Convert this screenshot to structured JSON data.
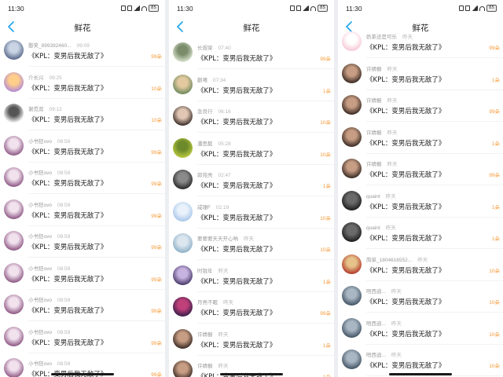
{
  "colors": {
    "accent": "#29a8ee",
    "count": "#f59a3a",
    "page_bg": "#eceef2"
  },
  "panels": [
    {
      "status": {
        "time": "11:30",
        "battery": "85"
      },
      "header": {
        "title": "鲜花",
        "back_icon": "back-arrow-icon"
      },
      "rows": [
        {
          "name": "憨笑_899392460...",
          "time": "09:09",
          "text": "《KPL：变男后我无敌了》",
          "count": "99朵",
          "avatar": [
            "#5a6a8c",
            "#c9d4e4"
          ]
        },
        {
          "name": "介长兴",
          "time": "09:25",
          "text": "《KPL：变男后我无敌了》",
          "count": "10朵",
          "avatar": [
            "#b48bd6",
            "#ffcf8a"
          ]
        },
        {
          "name": "谢觅双",
          "time": "09:12",
          "text": "《KPL：变男后我无敌了》",
          "count": "10朵",
          "avatar": [
            "#ffffff",
            "#555555"
          ]
        },
        {
          "name": "小书狂ovo",
          "time": "08:59",
          "text": "《KPL：变男后我无敌了》",
          "count": "99朵",
          "avatar": [
            "#8f5a86",
            "#f2e2ee"
          ]
        },
        {
          "name": "小书狂ovo",
          "time": "08:59",
          "text": "《KPL：变男后我无敌了》",
          "count": "99朵",
          "avatar": [
            "#8f5a86",
            "#f2e2ee"
          ]
        },
        {
          "name": "小书狂ovo",
          "time": "08:59",
          "text": "《KPL：变男后我无敌了》",
          "count": "99朵",
          "avatar": [
            "#8f5a86",
            "#f2e2ee"
          ]
        },
        {
          "name": "小书狂ovo",
          "time": "08:59",
          "text": "《KPL：变男后我无敌了》",
          "count": "99朵",
          "avatar": [
            "#8f5a86",
            "#f2e2ee"
          ]
        },
        {
          "name": "小书狂ovo",
          "time": "08:59",
          "text": "《KPL：变男后我无敌了》",
          "count": "99朵",
          "avatar": [
            "#8f5a86",
            "#f2e2ee"
          ]
        },
        {
          "name": "小书狂ovo",
          "time": "08:59",
          "text": "《KPL：变男后我无敌了》",
          "count": "99朵",
          "avatar": [
            "#8f5a86",
            "#f2e2ee"
          ]
        },
        {
          "name": "小书狂ovo",
          "time": "08:59",
          "text": "《KPL：变男后我无敌了》",
          "count": "99朵",
          "avatar": [
            "#8f5a86",
            "#f2e2ee"
          ]
        },
        {
          "name": "小书狂ovo",
          "time": "08:59",
          "text": "《KPL：变男后我无敌了》",
          "count": "99朵",
          "avatar": [
            "#8f5a86",
            "#f2e2ee"
          ]
        }
      ]
    },
    {
      "status": {
        "time": "11:30",
        "battery": "85"
      },
      "header": {
        "title": "鲜花",
        "back_icon": "back-arrow-icon"
      },
      "rows": [
        {
          "name": "长煜梁",
          "time": "07:40",
          "text": "《KPL：变男后我无敌了》",
          "count": "99朵",
          "avatar": [
            "#d8e3cf",
            "#7a8c6a"
          ]
        },
        {
          "name": "蒯嘻",
          "time": "07:34",
          "text": "《KPL：变男后我无敌了》",
          "count": "1朵",
          "avatar": [
            "#6f8a5e",
            "#e3c9a0"
          ]
        },
        {
          "name": "急良行",
          "time": "06:16",
          "text": "《KPL：变男后我无敌了》",
          "count": "10朵",
          "avatar": [
            "#3c2f2b",
            "#e0c6b3"
          ]
        },
        {
          "name": "潘思懿",
          "time": "05:28",
          "text": "《KPL：变男后我无敌了》",
          "count": "10朵",
          "avatar": [
            "#b9c940",
            "#6d8a2a"
          ]
        },
        {
          "name": "郎宛亮",
          "time": "02:47",
          "text": "《KPL：变男后我无敌了》",
          "count": "1朵",
          "avatar": [
            "#2a2a2a",
            "#8a8a8a"
          ]
        },
        {
          "name": "咸珊F",
          "time": "02:19",
          "text": "《KPL：变男后我无敌了》",
          "count": "10朵",
          "avatar": [
            "#a9c8ea",
            "#e9f1fb"
          ]
        },
        {
          "name": "要要要天天开心呐",
          "time": "昨天",
          "text": "《KPL：变男后我无敌了》",
          "count": "10朵",
          "avatar": [
            "#8fb0c9",
            "#dbe6ee"
          ]
        },
        {
          "name": "时锟年",
          "time": "昨天",
          "text": "《KPL：变男后我无敌了》",
          "count": "1朵",
          "avatar": [
            "#4a3a6a",
            "#c7b3e0"
          ]
        },
        {
          "name": "月亮不眠",
          "time": "昨天",
          "text": "《KPL：变男后我无敌了》",
          "count": "99朵",
          "avatar": [
            "#3a1e4a",
            "#c0407a"
          ]
        },
        {
          "name": "许婧橱",
          "time": "昨天",
          "text": "《KPL：变男后我无敌了》",
          "count": "1朵",
          "avatar": [
            "#3b2b24",
            "#c79d84"
          ]
        },
        {
          "name": "许婧橱",
          "time": "昨天",
          "text": "《KPL：变男后我无敌了》",
          "count": "1朵",
          "avatar": [
            "#3b2b24",
            "#c79d84"
          ]
        }
      ]
    },
    {
      "status": {
        "time": "11:30",
        "battery": "85"
      },
      "header": {
        "title": "鲜花",
        "back_icon": "back-arrow-icon"
      },
      "rows": [
        {
          "name": "奶茶还是可乐",
          "time": "昨天",
          "text": "《KPL：变男后我无敌了》",
          "count": "99朵",
          "avatar": [
            "#f7c9d6",
            "#ffffff"
          ]
        },
        {
          "name": "许婧橱",
          "time": "昨天",
          "text": "《KPL：变男后我无敌了》",
          "count": "1朵",
          "avatar": [
            "#3b2b24",
            "#c79d84"
          ]
        },
        {
          "name": "许婧橱",
          "time": "昨天",
          "text": "《KPL：变男后我无敌了》",
          "count": "99朵",
          "avatar": [
            "#3b2b24",
            "#c79d84"
          ]
        },
        {
          "name": "许婧橱",
          "time": "昨天",
          "text": "《KPL：变男后我无敌了》",
          "count": "1朵",
          "avatar": [
            "#3b2b24",
            "#c79d84"
          ]
        },
        {
          "name": "许婧橱",
          "time": "昨天",
          "text": "《KPL：变男后我无敌了》",
          "count": "99朵",
          "avatar": [
            "#3b2b24",
            "#c79d84"
          ]
        },
        {
          "name": "quaint",
          "time": "昨天",
          "text": "《KPL：变男后我无敌了》",
          "count": "1朵",
          "avatar": [
            "#1e1e1e",
            "#6a6a6a"
          ]
        },
        {
          "name": "quaint",
          "time": "昨天",
          "text": "《KPL：变男后我无敌了》",
          "count": "1朵",
          "avatar": [
            "#1e1e1e",
            "#6a6a6a"
          ]
        },
        {
          "name": "简单_1804616552...",
          "time": "昨天",
          "text": "《KPL：变男后我无敌了》",
          "count": "10朵",
          "avatar": [
            "#b33a2a",
            "#e6c28a"
          ]
        },
        {
          "name": "唔西迪...",
          "time": "昨天",
          "text": "《KPL：变男后我无敌了》",
          "count": "10朵",
          "avatar": [
            "#445566",
            "#a9b7c4"
          ]
        },
        {
          "name": "唔西迪...",
          "time": "昨天",
          "text": "《KPL：变男后我无敌了》",
          "count": "10朵",
          "avatar": [
            "#445566",
            "#a9b7c4"
          ]
        },
        {
          "name": "唔西迪...",
          "time": "昨天",
          "text": "《KPL：变男后我无敌了》",
          "count": "10朵",
          "avatar": [
            "#445566",
            "#a9b7c4"
          ]
        }
      ]
    }
  ]
}
